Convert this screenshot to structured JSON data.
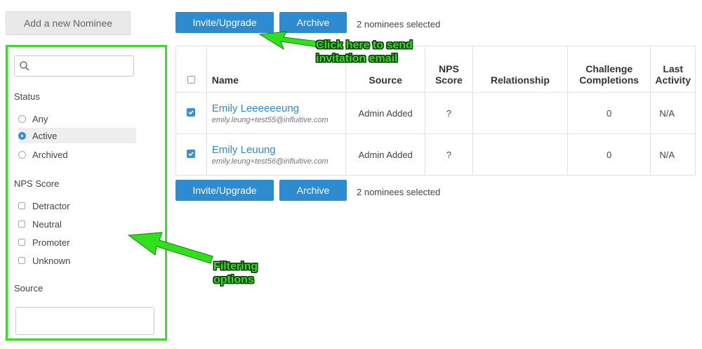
{
  "add_nominee_label": "Add a new Nominee",
  "sidebar": {
    "search_placeholder": "",
    "status": {
      "label": "Status",
      "options": [
        "Any",
        "Active",
        "Archived"
      ],
      "selected": "Active"
    },
    "nps": {
      "label": "NPS Score",
      "options": [
        "Detractor",
        "Neutral",
        "Promoter",
        "Unknown"
      ]
    },
    "source": {
      "label": "Source",
      "value": ""
    }
  },
  "actions": {
    "invite_label": "Invite/Upgrade",
    "archive_label": "Archive",
    "selected_text": "2 nominees selected"
  },
  "table": {
    "headers": {
      "name": "Name",
      "source": "Source",
      "nps_line1": "NPS",
      "nps_line2": "Score",
      "relationship": "Relationship",
      "challenge_line1": "Challenge",
      "challenge_line2": "Completions",
      "last_line1": "Last",
      "last_line2": "Activity"
    },
    "rows": [
      {
        "name": "Emily Leeeeeeung",
        "email": "emily.leung+test55@influitive.com",
        "source": "Admin Added",
        "nps": "?",
        "relationship": "",
        "challenges": "0",
        "last_activity": "N/A",
        "checked": true
      },
      {
        "name": "Emily Leuung",
        "email": "emily.leung+test56@influitive.com",
        "source": "Admin Added",
        "nps": "?",
        "relationship": "",
        "challenges": "0",
        "last_activity": "N/A",
        "checked": true
      }
    ]
  },
  "annotations": {
    "invite_line1": "Click here to send",
    "invite_line2": "invitation email",
    "filter_line1": "Filtering",
    "filter_line2": "options"
  },
  "colors": {
    "accent": "#2d8bd0",
    "annotation_green": "#2fe01a",
    "sidebar_border": "#3dd92b"
  }
}
